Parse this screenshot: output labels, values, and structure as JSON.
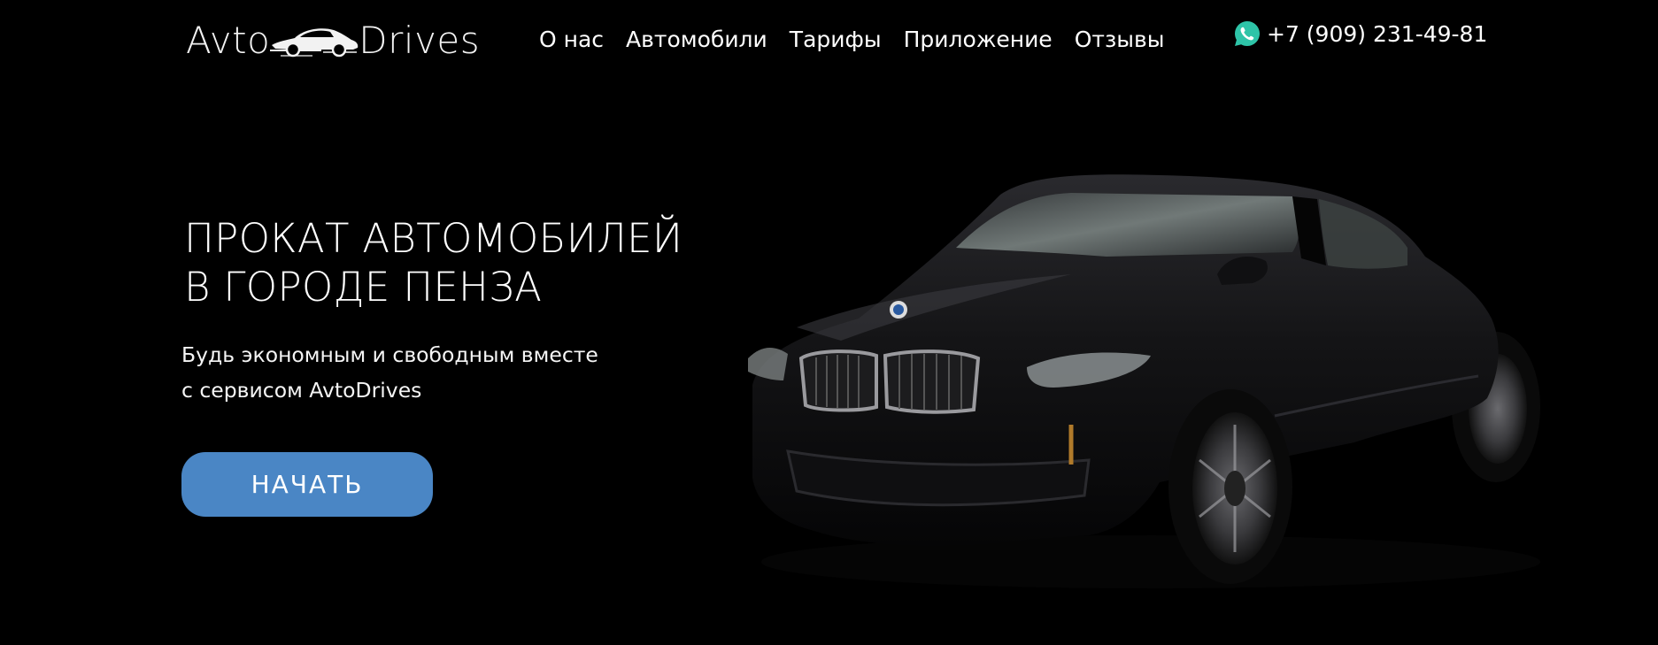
{
  "header": {
    "logo": {
      "left": "Avto",
      "right": "Drives",
      "icon": "car-logo-icon"
    },
    "nav": [
      {
        "label": "О нас"
      },
      {
        "label": "Автомобили"
      },
      {
        "label": "Тарифы"
      },
      {
        "label": "Приложение"
      },
      {
        "label": "Отзывы"
      }
    ],
    "phone": {
      "icon": "whatsapp-icon",
      "number": "+7 (909) 231-49-81"
    }
  },
  "hero": {
    "title_line1": "ПРОКАТ АВТОМОБИЛЕЙ",
    "title_line2": "В ГОРОДЕ ПЕНЗА",
    "subtitle_line1": "Будь экономным и свободным вместе",
    "subtitle_line2": "с сервисом AvtoDrives",
    "cta_label": "НАЧАТЬ"
  },
  "colors": {
    "background": "#000000",
    "accent_button": "#4a86c5",
    "whatsapp": "#2ec4a8",
    "text": "#ffffff"
  }
}
